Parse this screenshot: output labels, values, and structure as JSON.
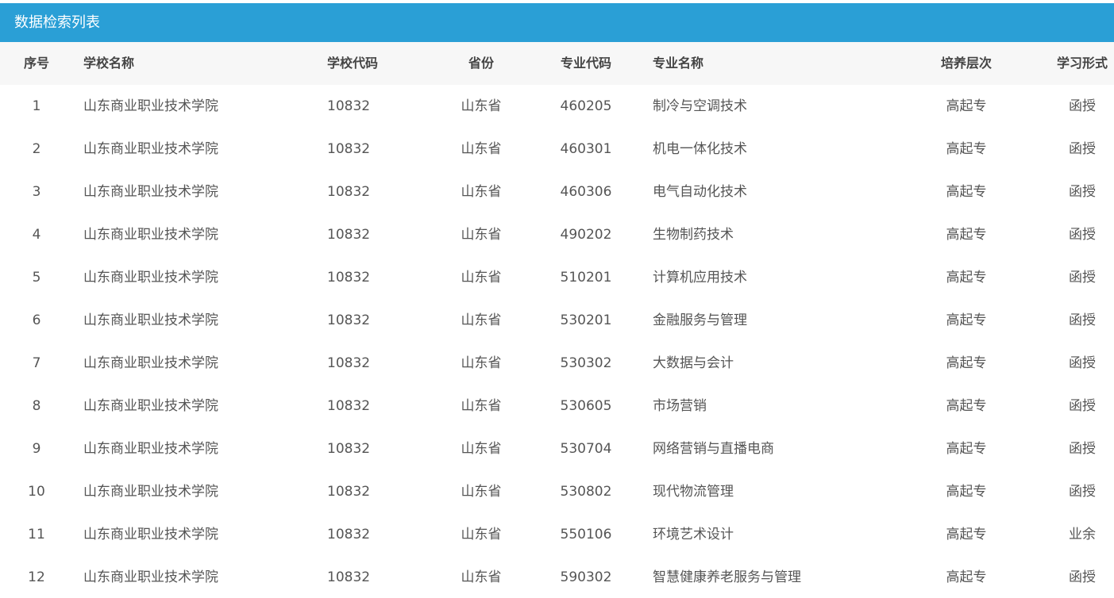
{
  "panel": {
    "title": "数据检索列表"
  },
  "columns": {
    "index": "序号",
    "school_name": "学校名称",
    "school_code": "学校代码",
    "province": "省份",
    "major_code": "专业代码",
    "major_name": "专业名称",
    "level": "培养层次",
    "study_form": "学习形式"
  },
  "rows": [
    {
      "index": "1",
      "school_name": "山东商业职业技术学院",
      "school_code": "10832",
      "province": "山东省",
      "major_code": "460205",
      "major_name": "制冷与空调技术",
      "level": "高起专",
      "study_form": "函授"
    },
    {
      "index": "2",
      "school_name": "山东商业职业技术学院",
      "school_code": "10832",
      "province": "山东省",
      "major_code": "460301",
      "major_name": "机电一体化技术",
      "level": "高起专",
      "study_form": "函授"
    },
    {
      "index": "3",
      "school_name": "山东商业职业技术学院",
      "school_code": "10832",
      "province": "山东省",
      "major_code": "460306",
      "major_name": "电气自动化技术",
      "level": "高起专",
      "study_form": "函授"
    },
    {
      "index": "4",
      "school_name": "山东商业职业技术学院",
      "school_code": "10832",
      "province": "山东省",
      "major_code": "490202",
      "major_name": "生物制药技术",
      "level": "高起专",
      "study_form": "函授"
    },
    {
      "index": "5",
      "school_name": "山东商业职业技术学院",
      "school_code": "10832",
      "province": "山东省",
      "major_code": "510201",
      "major_name": "计算机应用技术",
      "level": "高起专",
      "study_form": "函授"
    },
    {
      "index": "6",
      "school_name": "山东商业职业技术学院",
      "school_code": "10832",
      "province": "山东省",
      "major_code": "530201",
      "major_name": "金融服务与管理",
      "level": "高起专",
      "study_form": "函授"
    },
    {
      "index": "7",
      "school_name": "山东商业职业技术学院",
      "school_code": "10832",
      "province": "山东省",
      "major_code": "530302",
      "major_name": "大数据与会计",
      "level": "高起专",
      "study_form": "函授"
    },
    {
      "index": "8",
      "school_name": "山东商业职业技术学院",
      "school_code": "10832",
      "province": "山东省",
      "major_code": "530605",
      "major_name": "市场营销",
      "level": "高起专",
      "study_form": "函授"
    },
    {
      "index": "9",
      "school_name": "山东商业职业技术学院",
      "school_code": "10832",
      "province": "山东省",
      "major_code": "530704",
      "major_name": "网络营销与直播电商",
      "level": "高起专",
      "study_form": "函授"
    },
    {
      "index": "10",
      "school_name": "山东商业职业技术学院",
      "school_code": "10832",
      "province": "山东省",
      "major_code": "530802",
      "major_name": "现代物流管理",
      "level": "高起专",
      "study_form": "函授"
    },
    {
      "index": "11",
      "school_name": "山东商业职业技术学院",
      "school_code": "10832",
      "province": "山东省",
      "major_code": "550106",
      "major_name": "环境艺术设计",
      "level": "高起专",
      "study_form": "业余"
    },
    {
      "index": "12",
      "school_name": "山东商业职业技术学院",
      "school_code": "10832",
      "province": "山东省",
      "major_code": "590302",
      "major_name": "智慧健康养老服务与管理",
      "level": "高起专",
      "study_form": "函授"
    }
  ],
  "colors": {
    "title_bar": "#2a9fd6",
    "header_bg": "#f7f7f7",
    "text": "#555555"
  }
}
